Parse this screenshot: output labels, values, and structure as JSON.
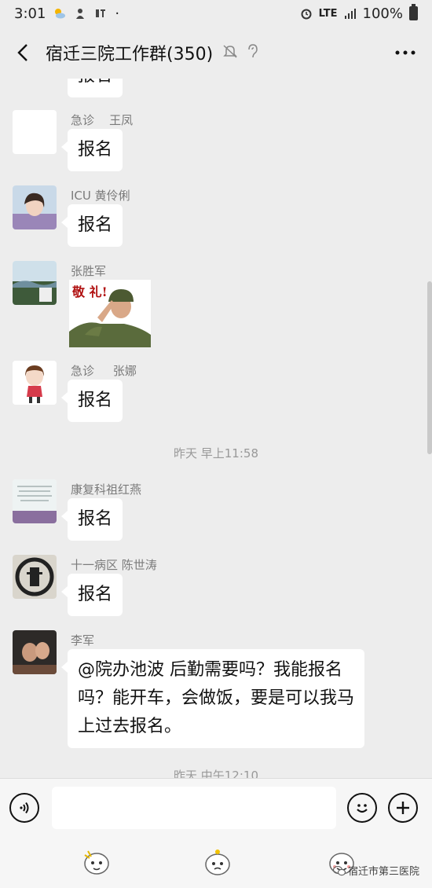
{
  "status_bar": {
    "time": "3:01",
    "network": "LTE",
    "battery": "100%"
  },
  "header": {
    "title": "宿迁三院工作群(350)"
  },
  "chat": {
    "top_partial_text": "报名",
    "messages": [
      {
        "sender": "急诊    王凤",
        "text": "报名"
      },
      {
        "sender": "ICU 黄伶俐",
        "text": "报名"
      },
      {
        "sender": "张胜军",
        "sticker_text": "敬 礼!"
      },
      {
        "sender": "急诊     张娜",
        "text": "报名"
      },
      {
        "sender": "康复科祖红燕",
        "text": "报名"
      },
      {
        "sender": "十一病区 陈世涛",
        "text": "报名"
      },
      {
        "sender": "李军",
        "text_lines": [
          "@院办池波  后勤需要吗？我能报名",
          "吗？能开车，会做饭，要是可以我马",
          "上过去报名。"
        ]
      }
    ],
    "timestamps": [
      "昨天 早上11:58",
      "昨天 中午12:10"
    ]
  },
  "input_bar": {
    "placeholder": ""
  },
  "watermark": {
    "text": "宿迁市第三医院"
  },
  "colors": {
    "background": "#ededed",
    "bubble": "#ffffff",
    "sender_text": "#7b7b7b",
    "timestamp": "#999999"
  }
}
